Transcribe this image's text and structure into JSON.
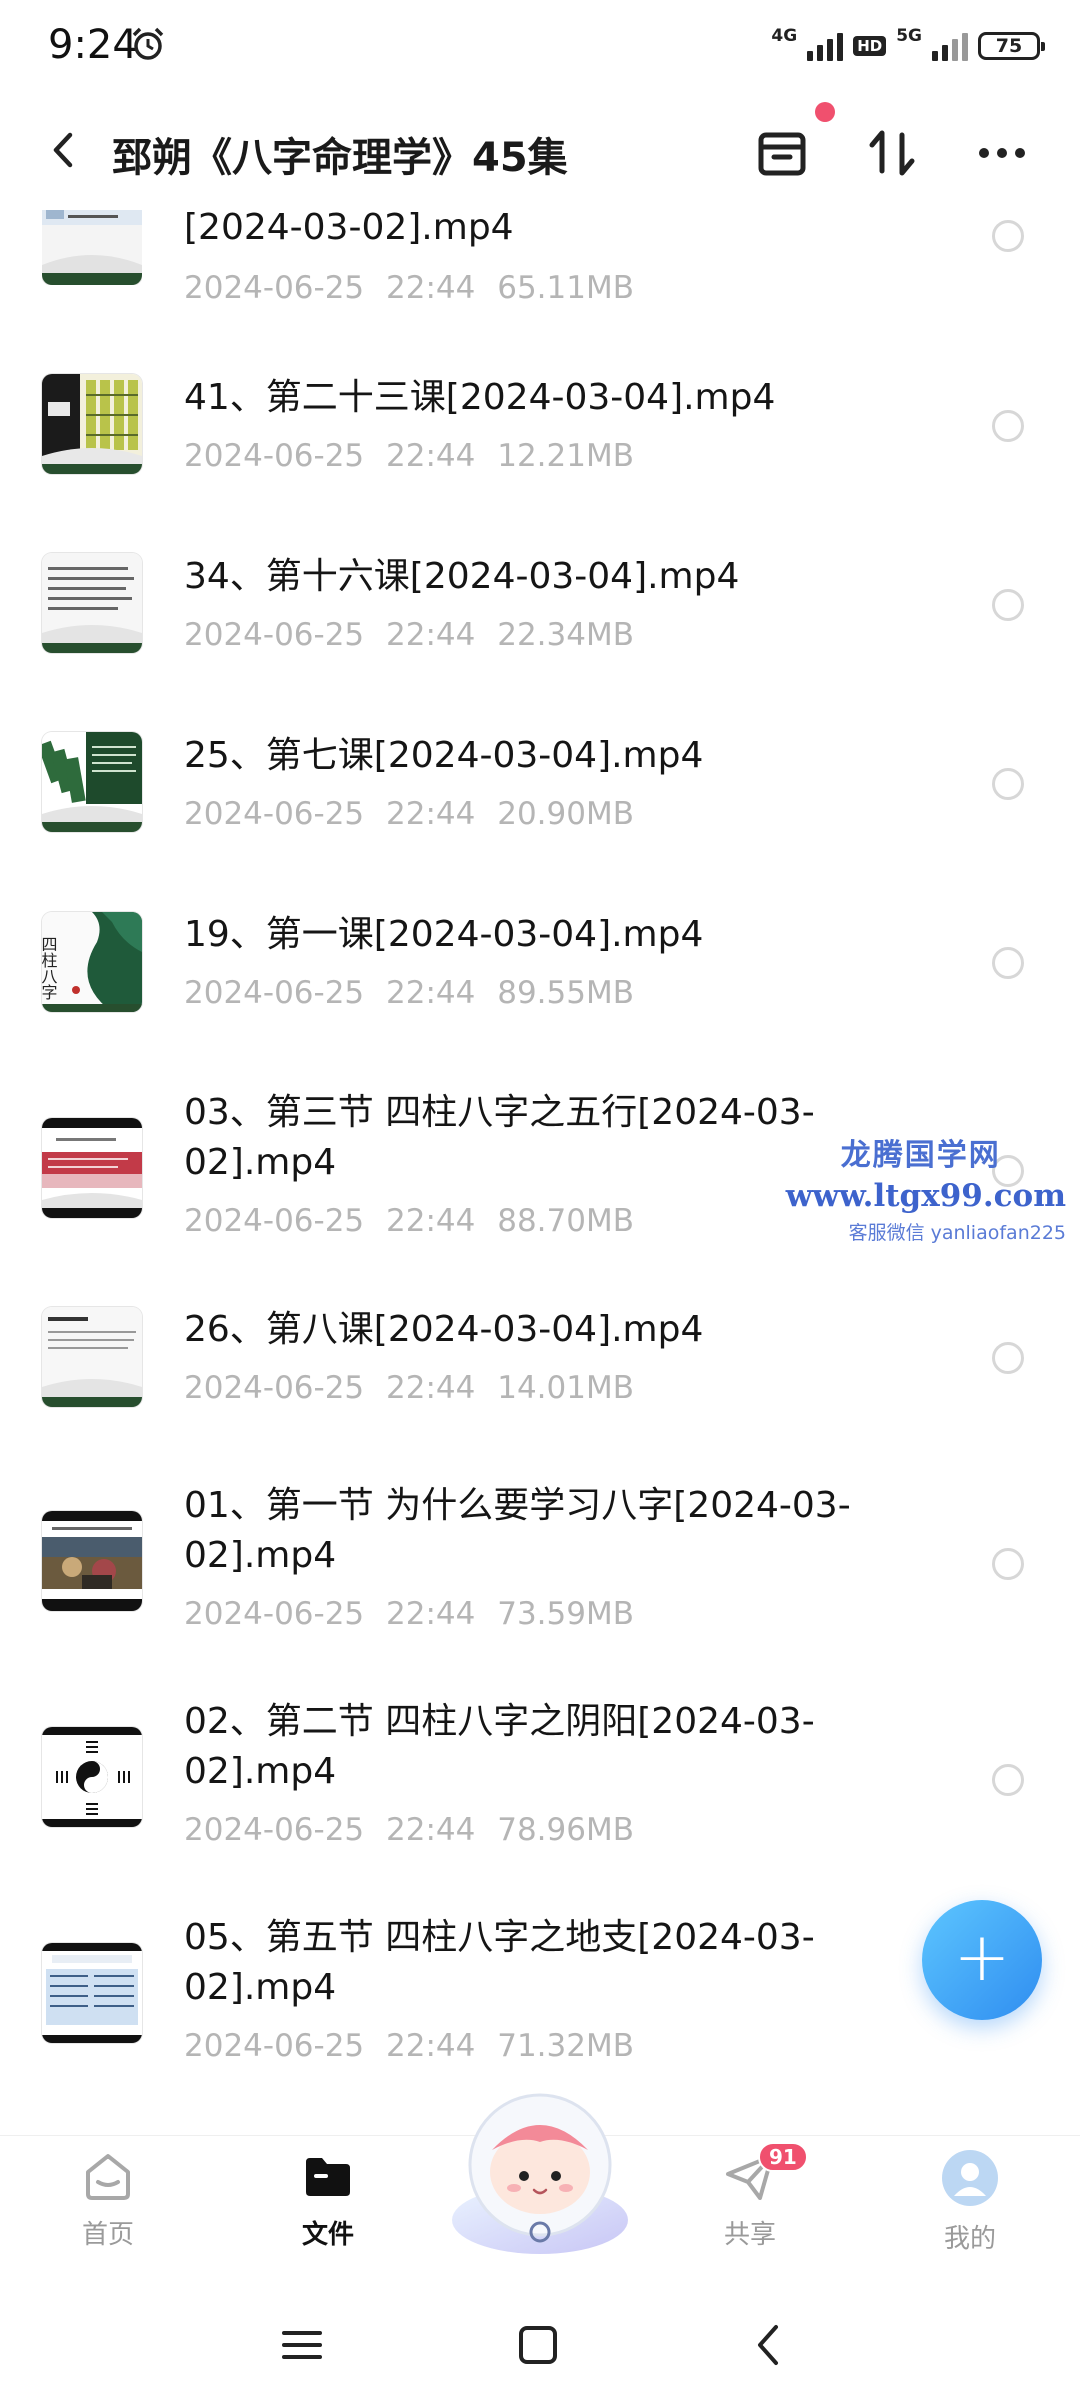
{
  "status_bar": {
    "time": "9:24",
    "network_1": "4G",
    "hd": "HD",
    "network_2": "5G",
    "battery": "75"
  },
  "header": {
    "title": "郅朔《八字命理学》45集"
  },
  "files": [
    {
      "name": "[2024-03-02].mp4",
      "date": "2024-06-25",
      "time": "22:44",
      "size": "65.11MB",
      "thumb": "thumb-document-table"
    },
    {
      "name": "41、第二十三课[2024-03-04].mp4",
      "date": "2024-06-25",
      "time": "22:44",
      "size": "12.21MB",
      "thumb": "thumb-green-chart"
    },
    {
      "name": "34、第十六课[2024-03-04].mp4",
      "date": "2024-06-25",
      "time": "22:44",
      "size": "22.34MB",
      "thumb": "thumb-text-slide"
    },
    {
      "name": "25、第七课[2024-03-04].mp4",
      "date": "2024-06-25",
      "time": "22:44",
      "size": "20.90MB",
      "thumb": "thumb-green-book"
    },
    {
      "name": "19、第一课[2024-03-04].mp4",
      "date": "2024-06-25",
      "time": "22:44",
      "size": "89.55MB",
      "thumb": "thumb-sizhu-bazi-cover",
      "thumb_text": "四柱八字"
    },
    {
      "name": "03、第三节 四柱八字之五行[2024-03-02].mp4",
      "date": "2024-06-25",
      "time": "22:44",
      "size": "88.70MB",
      "thumb": "thumb-red-banner"
    },
    {
      "name": "26、第八课[2024-03-04].mp4",
      "date": "2024-06-25",
      "time": "22:44",
      "size": "14.01MB",
      "thumb": "thumb-text-slide"
    },
    {
      "name": "01、第一节 为什么要学习八字[2024-03-02].mp4",
      "date": "2024-06-25",
      "time": "22:44",
      "size": "73.59MB",
      "thumb": "thumb-painting"
    },
    {
      "name": "02、第二节 四柱八字之阴阳[2024-03-02].mp4",
      "date": "2024-06-25",
      "time": "22:44",
      "size": "78.96MB",
      "thumb": "thumb-yinyang-bagua"
    },
    {
      "name": "05、第五节 四柱八字之地支[2024-03-02].mp4",
      "date": "2024-06-25",
      "time": "22:44",
      "size": "71.32MB",
      "thumb": "thumb-blue-table"
    }
  ],
  "watermark": {
    "title": "龙腾国学网",
    "url": "www.ltgx99.com",
    "contact": "客服微信 yanliaofan225"
  },
  "fab": {
    "icon": "plus-icon",
    "label": "+"
  },
  "bottom_nav": [
    {
      "label": "首页",
      "icon": "home-icon",
      "active": false
    },
    {
      "label": "文件",
      "icon": "folder-icon",
      "active": true
    },
    {
      "label": "共享",
      "icon": "paper-plane-icon",
      "active": false,
      "badge": "91"
    },
    {
      "label": "我的",
      "icon": "profile-icon",
      "active": false
    }
  ],
  "colors": {
    "accent": "#2f8df0",
    "badge": "#f0506e",
    "meta_text": "#b5b5b5",
    "watermark": "#4a6fd1"
  }
}
